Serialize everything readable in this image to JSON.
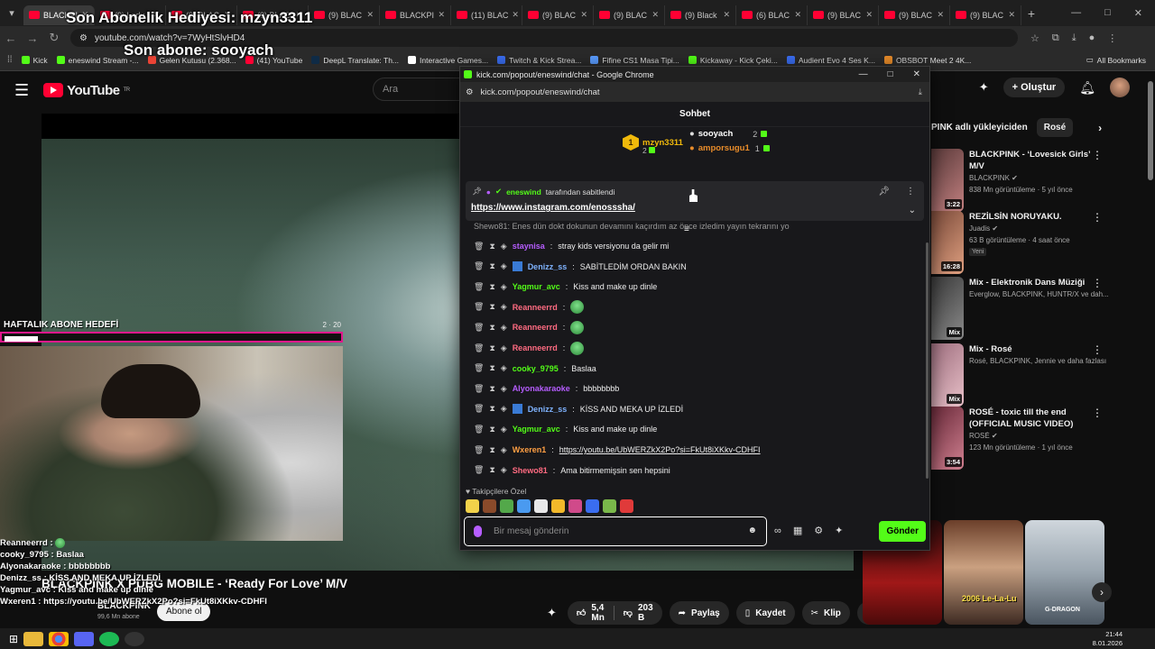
{
  "browser": {
    "tabs": [
      {
        "label": "BLACKPI"
      },
      {
        "label": "(9) Lady"
      },
      {
        "label": "(9) BLAC"
      },
      {
        "label": "(9) BLAC"
      },
      {
        "label": "(9) BLAC"
      },
      {
        "label": "BLACKPI"
      },
      {
        "label": "(11) BLAC"
      },
      {
        "label": "(9) BLAC"
      },
      {
        "label": "(9) BLAC"
      },
      {
        "label": "(9) Black"
      },
      {
        "label": "(6) BLAC"
      },
      {
        "label": "(9) BLAC"
      },
      {
        "label": "(9) BLAC"
      },
      {
        "label": "(9) BLAC"
      }
    ],
    "url": "youtube.com/watch?v=7WyHtSlvHD4",
    "bookmarks": [
      {
        "label": "Kick",
        "color": "#53fc18"
      },
      {
        "label": "eneswind Stream -...",
        "color": "#53fc18"
      },
      {
        "label": "Gelen Kutusu (2.368...",
        "color": "#ea4335"
      },
      {
        "label": "(41) YouTube",
        "color": "#ff0033"
      },
      {
        "label": "DeepL Translate: Th...",
        "color": "#0f2b46"
      },
      {
        "label": "Interactive Games...",
        "color": "#ffffff"
      },
      {
        "label": "Twitch & Kick Strea...",
        "color": "#3a6df0"
      },
      {
        "label": "Fifine CS1 Masa Tipi...",
        "color": "#5a9cff"
      },
      {
        "label": "Kickaway - Kick Çeki...",
        "color": "#53fc18"
      },
      {
        "label": "Audient Evo 4 Ses K...",
        "color": "#3a6df0"
      },
      {
        "label": "OBSBOT Meet 2 4K...",
        "color": "#e88c2a"
      }
    ],
    "all_bookmarks": "All Bookmarks"
  },
  "stream_overlay": {
    "last_gift": "Son Abonelik Hediyesi: mzyn3311",
    "last_sub": "Son abone: sooyach",
    "weekly_goal_label": "HAFTALIK ABONE HEDEFİ",
    "weekly_goal_current": "2",
    "weekly_goal_target": "20",
    "weekly_goal_progress": 0.1,
    "chat": [
      {
        "user": "Reanneerrd",
        "text": ""
      },
      {
        "user": "cooky_9795",
        "text": "Baslaa"
      },
      {
        "user": "Alyonakaraoke",
        "text": "bbbbbbbb"
      },
      {
        "user": "Denizz_ss",
        "text": "KİSS AND MEKA UP İZLEDİ"
      },
      {
        "user": "Yagmur_avc",
        "text": "Kiss and make up dinle"
      },
      {
        "user": "Wxeren1",
        "text": "https://youtu.be/UbWERZkX2Po?si=FkUt8iXKkv-CDHFI"
      }
    ]
  },
  "youtube": {
    "logo": "YouTube",
    "logo_region": "TR",
    "search_placeholder": "Ara",
    "create_label": "Oluştur",
    "video_title": "BLACKPINK X PUBG MOBILE - ‘Ready For Love’ M/V",
    "channel": "BLACKPINK",
    "subscribers": "99,6 Mn abone",
    "subscribe_label": "Abone ol",
    "likes": "5,4 Mn",
    "dislikes": "203 B",
    "share_label": "Paylaş",
    "save_label": "Kaydet",
    "clip_label": "Klip",
    "chips": [
      "PINK adlı yükleyiciden",
      "Rosé"
    ],
    "recommendations": [
      {
        "title": "BLACKPINK - ‘Lovesick Girls’ M/V",
        "channel": "BLACKPINK",
        "meta": "838 Mn görüntüleme · 5 yıl önce",
        "duration": "3:22"
      },
      {
        "title": "REZİLSİN NORUYAKU.",
        "channel": "Juadis",
        "meta": "63 B görüntüleme · 4 saat önce",
        "duration": "16:28",
        "badge": "Yeni"
      },
      {
        "title": "Mix - Elektronik Dans Müziği",
        "channel": "",
        "meta": "Everglow, BLACKPINK, HUNTR/X ve dah...",
        "duration": "Mix"
      },
      {
        "title": "Mix - Rosé",
        "channel": "",
        "meta": "Rosé, BLACKPINK, Jennie ve daha fazlası",
        "duration": "Mix"
      },
      {
        "title": "ROSÉ - toxic till the end (OFFICIAL MUSIC VIDEO)",
        "channel": "ROSÉ",
        "meta": "123 Mn görüntüleme · 1 yıl önce",
        "duration": "3:54"
      }
    ],
    "shorts": [
      {
        "caption": ""
      },
      {
        "caption": "2006 Le-La-Lu"
      },
      {
        "caption": "G-DRAGON"
      }
    ]
  },
  "kick_popup": {
    "window_title": "kick.com/popout/eneswind/chat - Google Chrome",
    "url": "kick.com/popout/eneswind/chat",
    "header": "Sohbet",
    "top_gifters": [
      {
        "rank": "1",
        "name": "mzyn3311",
        "count": "2"
      },
      {
        "rank": "",
        "name": "sooyach",
        "count": "2"
      },
      {
        "rank": "",
        "name": "amporsugu1",
        "count": "1"
      }
    ],
    "pinned_by_user": "eneswind",
    "pinned_by_suffix": "tarafından sabitlendi",
    "pinned_link": "https://www.instagram.com/enosssha/",
    "partial_message": "Shewo81: Enes dün dokt dokunun devamını kaçırdım az önce izledim yayın tekrarını yo",
    "messages": [
      {
        "user": "staynisa",
        "text": "stray kids versiyonu da gelir mi",
        "color": "#b65dff",
        "emote": false
      },
      {
        "user": "Denizz_ss",
        "text": "SABİTLEDİM ORDAN BAKIN",
        "color": "#7fb3ff",
        "emote": false
      },
      {
        "user": "Yagmur_avc",
        "text": "Kiss and make up dinle",
        "color": "#53fc18",
        "emote": false
      },
      {
        "user": "Reanneerrd",
        "text": "",
        "color": "#ff6b81",
        "emote": true
      },
      {
        "user": "Reanneerrd",
        "text": "",
        "color": "#ff6b81",
        "emote": true
      },
      {
        "user": "Reanneerrd",
        "text": "",
        "color": "#ff6b81",
        "emote": true
      },
      {
        "user": "cooky_9795",
        "text": "Baslaa",
        "color": "#53fc18",
        "emote": false
      },
      {
        "user": "Alyonakaraoke",
        "text": "bbbbbbbb",
        "color": "#b65dff",
        "emote": false
      },
      {
        "user": "Denizz_ss",
        "text": "KİSS AND MEKA UP İZLEDİ",
        "color": "#7fb3ff",
        "emote": false
      },
      {
        "user": "Yagmur_avc",
        "text": "Kiss and make up dinle",
        "color": "#53fc18",
        "emote": false
      },
      {
        "user": "Wxeren1",
        "text": "https://youtu.be/UbWERZkX2Po?si=FkUt8iXKkv-CDHFI",
        "color": "#ff9f43",
        "emote": false
      },
      {
        "user": "Shewo81",
        "text": "Ama bitirmemişsin sen hepsini",
        "color": "#ff6b81",
        "emote": false
      }
    ],
    "followers_only_label": "Takipçilere Özel",
    "input_placeholder": "Bir mesaj gönderin",
    "send_label": "Gönder"
  },
  "taskbar": {
    "time": "21:44",
    "date": "8.01.2026"
  }
}
